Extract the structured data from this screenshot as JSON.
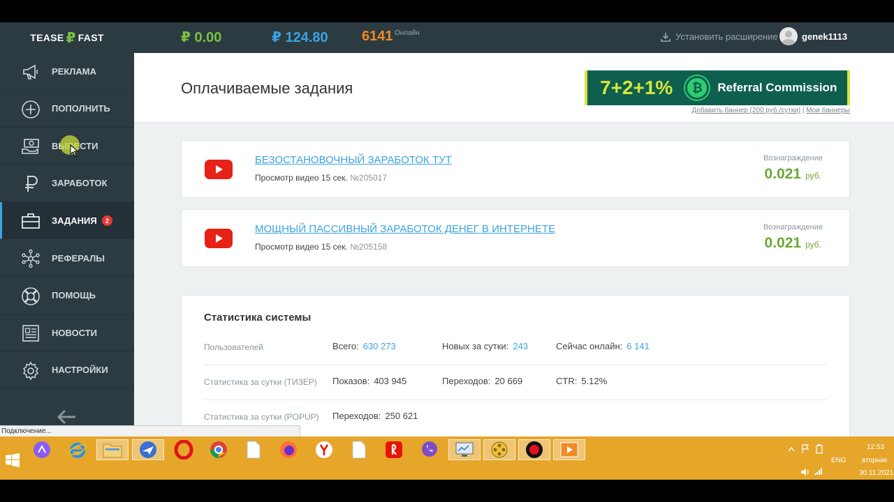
{
  "header": {
    "logo_left": "TEASE",
    "logo_rub": "₽",
    "logo_right": "FAST",
    "balance_main": "₽ 0.00",
    "balance_ad": "₽ 124.80",
    "online_count": "6141",
    "online_label": "Онлайн",
    "install_extension": "Установить расширение",
    "username": "genek1113"
  },
  "sidebar": {
    "items": [
      {
        "label": "РЕКЛАМА",
        "icon": "megaphone-icon"
      },
      {
        "label": "ПОПОЛНИТЬ",
        "icon": "plus-circle-icon"
      },
      {
        "label": "ВЫВЕСТИ",
        "icon": "cash-hand-icon"
      },
      {
        "label": "ЗАРАБОТОК",
        "icon": "ruble-icon"
      },
      {
        "label": "ЗАДАНИЯ",
        "icon": "briefcase-icon",
        "badge": "2",
        "active": true
      },
      {
        "label": "РЕФЕРАЛЫ",
        "icon": "network-icon"
      },
      {
        "label": "ПОМОЩЬ",
        "icon": "lifebuoy-icon"
      },
      {
        "label": "НОВОСТИ",
        "icon": "newspaper-icon"
      },
      {
        "label": "НАСТРОЙКИ",
        "icon": "gear-icon"
      }
    ]
  },
  "status_text": "Подключение...",
  "main": {
    "title": "Оплачиваемые задания",
    "banner": {
      "big": "7+2+1%",
      "coin": "₿",
      "text": "Referral Commission",
      "link_add": "Добавить баннер (200 руб./сутки)",
      "separator": "|",
      "link_mine": "Мои баннеры"
    },
    "tasks": [
      {
        "title": "БЕЗОСТАНОВОЧНЫЙ ЗАРАБОТОК ТУТ",
        "type": "Просмотр видео 15 сек.",
        "id": "№205017",
        "reward_label": "Вознаграждение",
        "reward": "0.021",
        "currency": "руб."
      },
      {
        "title": "МОЩНЫЙ ПАССИВНЫЙ ЗАРАБОТОК ДЕНЕГ В ИНТЕРНЕТЕ",
        "type": "Просмотр видео 15 сек.",
        "id": "№205158",
        "reward_label": "Вознаграждение",
        "reward": "0.021",
        "currency": "руб."
      }
    ],
    "stats": {
      "title": "Статистика системы",
      "rows": [
        {
          "category": "Пользователей",
          "cells": [
            {
              "label": "Всего:",
              "value": "630 273"
            },
            {
              "label": "Новых за сутки:",
              "value": "243"
            },
            {
              "label": "Сейчас онлайн:",
              "value": "6 141"
            }
          ]
        },
        {
          "category": "Статистика за сутки (ТИЗЕР)",
          "cells": [
            {
              "label": "Показов:",
              "value": "403 945"
            },
            {
              "label": "Переходов:",
              "value": "20 669"
            },
            {
              "label": "CTR:",
              "value": "5.12%"
            }
          ]
        },
        {
          "category": "Статистика за сутки (POPUP)",
          "cells": [
            {
              "label": "Переходов:",
              "value": "250 621"
            }
          ]
        }
      ]
    }
  },
  "taskbar": {
    "lang": "ENG",
    "time": "12:53",
    "weekday": "вторник",
    "date": "30.11.2021"
  },
  "colors": {
    "header_bg": "#2c3a41",
    "accent_blue": "#3aa3e3",
    "accent_green": "#7ac142",
    "accent_orange": "#f08a24",
    "taskbar": "#e6a62a"
  }
}
